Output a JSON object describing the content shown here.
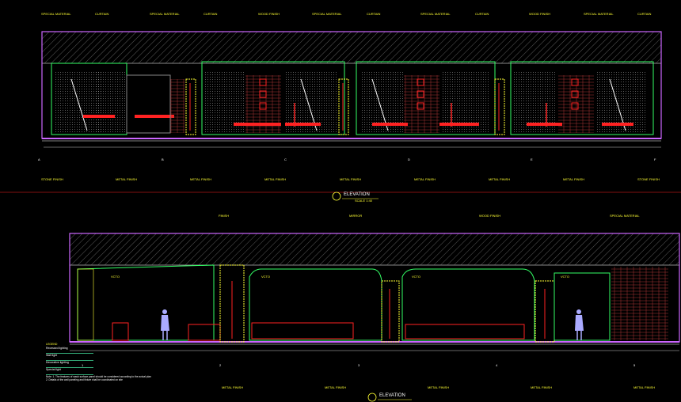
{
  "top_elevation": {
    "title": "ELEVATION",
    "scale_label": "SCALE 1:40",
    "callouts_top": [
      "SPECIAL MATERIAL",
      "CURTAIN",
      "SPECIAL MATERIAL",
      "CURTAIN",
      "WOOD FINISH",
      "SPECIAL MATERIAL",
      "CURTAIN",
      "SPECIAL MATERIAL",
      "CURTAIN",
      "WOOD FINISH",
      "SPECIAL MATERIAL",
      "CURTAIN"
    ],
    "callouts_bottom": [
      "STONE FINISH",
      "METAL FINISH",
      "METAL FINISH",
      "METAL FINISH",
      "METAL FINISH",
      "METAL FINISH",
      "METAL FINISH",
      "METAL FINISH",
      "STONE FINISH"
    ],
    "grid_markers": [
      "A",
      "B",
      "C",
      "D",
      "E",
      "F"
    ]
  },
  "bottom_elevation": {
    "title": "ELEVATION",
    "callouts_top": [
      "FINISH",
      "MIRROR",
      "WOOD FINISH",
      "SPECIAL MATERIAL"
    ],
    "callouts_bottom": [
      "METAL FINISH",
      "METAL FINISH",
      "METAL FINISH",
      "METAL FINISH",
      "METAL FINISH"
    ],
    "vents": [
      "VCTO",
      "VCTO",
      "VCTO",
      "VCTO"
    ],
    "grid_markers": [
      "1",
      "2",
      "3",
      "4",
      "5"
    ]
  },
  "legend": {
    "heading": "LEGEND",
    "rows": [
      "Recessed lighting",
      "Wall light",
      "Decorative lighting",
      "Special light"
    ]
  },
  "notes": [
    "Note: 1. The features of wash surface panel should be considered according to the actual plan",
    "2. Details of the wall paneling and fixture shall be coordinated on site"
  ],
  "colors": {
    "frame": "#cc66ff",
    "yellow": "#ffff33",
    "green": "#33ff66",
    "red": "#ff2222",
    "white": "#ffffff",
    "cyan": "#33ccff",
    "grey": "#888888"
  }
}
